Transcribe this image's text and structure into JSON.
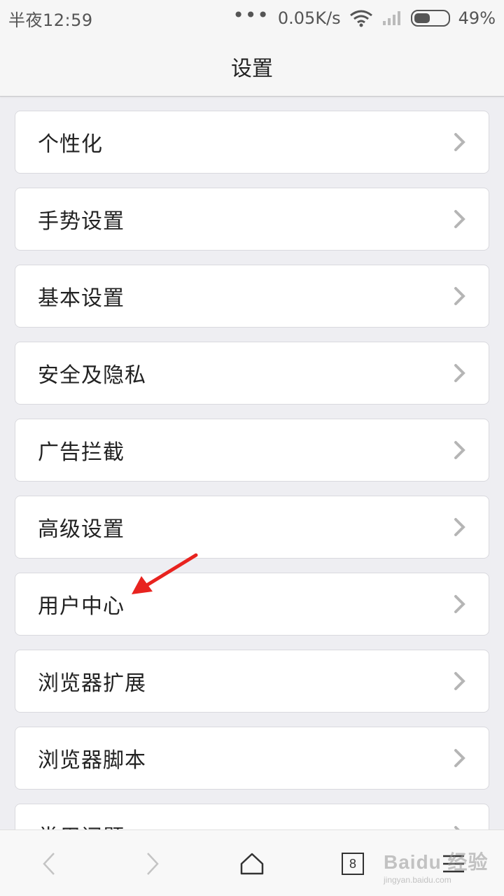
{
  "status_bar": {
    "time": "半夜12:59",
    "dots": "•••",
    "speed": "0.05K/s",
    "battery": "49%",
    "battery_level": 0.49
  },
  "header": {
    "title": "设置"
  },
  "settings": {
    "items": [
      {
        "label": "个性化"
      },
      {
        "label": "手势设置"
      },
      {
        "label": "基本设置"
      },
      {
        "label": "安全及隐私"
      },
      {
        "label": "广告拦截"
      },
      {
        "label": "高级设置"
      },
      {
        "label": "用户中心"
      },
      {
        "label": "浏览器扩展"
      },
      {
        "label": "浏览器脚本"
      },
      {
        "label": "常用问题"
      }
    ]
  },
  "bottom_nav": {
    "tab_count": "8"
  },
  "watermark": {
    "main": "Baidu 经验",
    "sub": "jingyan.baidu.com"
  },
  "colors": {
    "background": "#eeeef2",
    "card": "#ffffff",
    "chevron": "#b5b5b5",
    "annotation": "#e8231f"
  },
  "icons": {
    "wifi": "wifi-icon",
    "signal": "signal-icon",
    "battery": "battery-icon",
    "chevron": "chevron-right-icon",
    "back": "chevron-left-icon",
    "forward": "chevron-right-icon",
    "home": "home-icon",
    "tabs": "tabs-icon",
    "menu": "menu-icon"
  }
}
